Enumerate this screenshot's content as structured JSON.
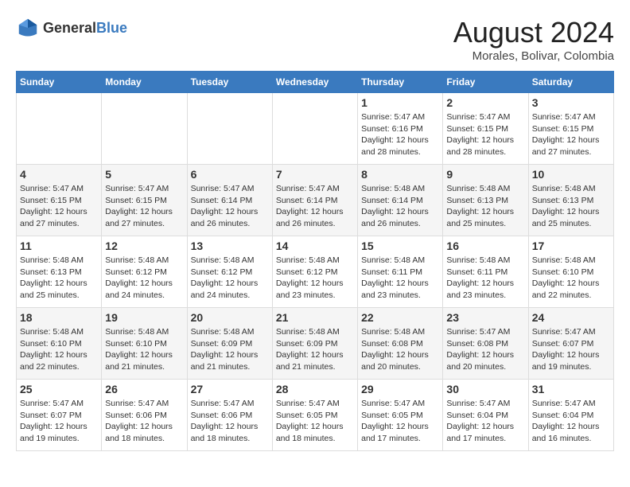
{
  "header": {
    "logo_general": "General",
    "logo_blue": "Blue",
    "title": "August 2024",
    "subtitle": "Morales, Bolivar, Colombia"
  },
  "days_of_week": [
    "Sunday",
    "Monday",
    "Tuesday",
    "Wednesday",
    "Thursday",
    "Friday",
    "Saturday"
  ],
  "weeks": [
    [
      {
        "day": "",
        "info": ""
      },
      {
        "day": "",
        "info": ""
      },
      {
        "day": "",
        "info": ""
      },
      {
        "day": "",
        "info": ""
      },
      {
        "day": "1",
        "info": "Sunrise: 5:47 AM\nSunset: 6:16 PM\nDaylight: 12 hours\nand 28 minutes."
      },
      {
        "day": "2",
        "info": "Sunrise: 5:47 AM\nSunset: 6:15 PM\nDaylight: 12 hours\nand 28 minutes."
      },
      {
        "day": "3",
        "info": "Sunrise: 5:47 AM\nSunset: 6:15 PM\nDaylight: 12 hours\nand 27 minutes."
      }
    ],
    [
      {
        "day": "4",
        "info": "Sunrise: 5:47 AM\nSunset: 6:15 PM\nDaylight: 12 hours\nand 27 minutes."
      },
      {
        "day": "5",
        "info": "Sunrise: 5:47 AM\nSunset: 6:15 PM\nDaylight: 12 hours\nand 27 minutes."
      },
      {
        "day": "6",
        "info": "Sunrise: 5:47 AM\nSunset: 6:14 PM\nDaylight: 12 hours\nand 26 minutes."
      },
      {
        "day": "7",
        "info": "Sunrise: 5:47 AM\nSunset: 6:14 PM\nDaylight: 12 hours\nand 26 minutes."
      },
      {
        "day": "8",
        "info": "Sunrise: 5:48 AM\nSunset: 6:14 PM\nDaylight: 12 hours\nand 26 minutes."
      },
      {
        "day": "9",
        "info": "Sunrise: 5:48 AM\nSunset: 6:13 PM\nDaylight: 12 hours\nand 25 minutes."
      },
      {
        "day": "10",
        "info": "Sunrise: 5:48 AM\nSunset: 6:13 PM\nDaylight: 12 hours\nand 25 minutes."
      }
    ],
    [
      {
        "day": "11",
        "info": "Sunrise: 5:48 AM\nSunset: 6:13 PM\nDaylight: 12 hours\nand 25 minutes."
      },
      {
        "day": "12",
        "info": "Sunrise: 5:48 AM\nSunset: 6:12 PM\nDaylight: 12 hours\nand 24 minutes."
      },
      {
        "day": "13",
        "info": "Sunrise: 5:48 AM\nSunset: 6:12 PM\nDaylight: 12 hours\nand 24 minutes."
      },
      {
        "day": "14",
        "info": "Sunrise: 5:48 AM\nSunset: 6:12 PM\nDaylight: 12 hours\nand 23 minutes."
      },
      {
        "day": "15",
        "info": "Sunrise: 5:48 AM\nSunset: 6:11 PM\nDaylight: 12 hours\nand 23 minutes."
      },
      {
        "day": "16",
        "info": "Sunrise: 5:48 AM\nSunset: 6:11 PM\nDaylight: 12 hours\nand 23 minutes."
      },
      {
        "day": "17",
        "info": "Sunrise: 5:48 AM\nSunset: 6:10 PM\nDaylight: 12 hours\nand 22 minutes."
      }
    ],
    [
      {
        "day": "18",
        "info": "Sunrise: 5:48 AM\nSunset: 6:10 PM\nDaylight: 12 hours\nand 22 minutes."
      },
      {
        "day": "19",
        "info": "Sunrise: 5:48 AM\nSunset: 6:10 PM\nDaylight: 12 hours\nand 21 minutes."
      },
      {
        "day": "20",
        "info": "Sunrise: 5:48 AM\nSunset: 6:09 PM\nDaylight: 12 hours\nand 21 minutes."
      },
      {
        "day": "21",
        "info": "Sunrise: 5:48 AM\nSunset: 6:09 PM\nDaylight: 12 hours\nand 21 minutes."
      },
      {
        "day": "22",
        "info": "Sunrise: 5:48 AM\nSunset: 6:08 PM\nDaylight: 12 hours\nand 20 minutes."
      },
      {
        "day": "23",
        "info": "Sunrise: 5:47 AM\nSunset: 6:08 PM\nDaylight: 12 hours\nand 20 minutes."
      },
      {
        "day": "24",
        "info": "Sunrise: 5:47 AM\nSunset: 6:07 PM\nDaylight: 12 hours\nand 19 minutes."
      }
    ],
    [
      {
        "day": "25",
        "info": "Sunrise: 5:47 AM\nSunset: 6:07 PM\nDaylight: 12 hours\nand 19 minutes."
      },
      {
        "day": "26",
        "info": "Sunrise: 5:47 AM\nSunset: 6:06 PM\nDaylight: 12 hours\nand 18 minutes."
      },
      {
        "day": "27",
        "info": "Sunrise: 5:47 AM\nSunset: 6:06 PM\nDaylight: 12 hours\nand 18 minutes."
      },
      {
        "day": "28",
        "info": "Sunrise: 5:47 AM\nSunset: 6:05 PM\nDaylight: 12 hours\nand 18 minutes."
      },
      {
        "day": "29",
        "info": "Sunrise: 5:47 AM\nSunset: 6:05 PM\nDaylight: 12 hours\nand 17 minutes."
      },
      {
        "day": "30",
        "info": "Sunrise: 5:47 AM\nSunset: 6:04 PM\nDaylight: 12 hours\nand 17 minutes."
      },
      {
        "day": "31",
        "info": "Sunrise: 5:47 AM\nSunset: 6:04 PM\nDaylight: 12 hours\nand 16 minutes."
      }
    ]
  ]
}
